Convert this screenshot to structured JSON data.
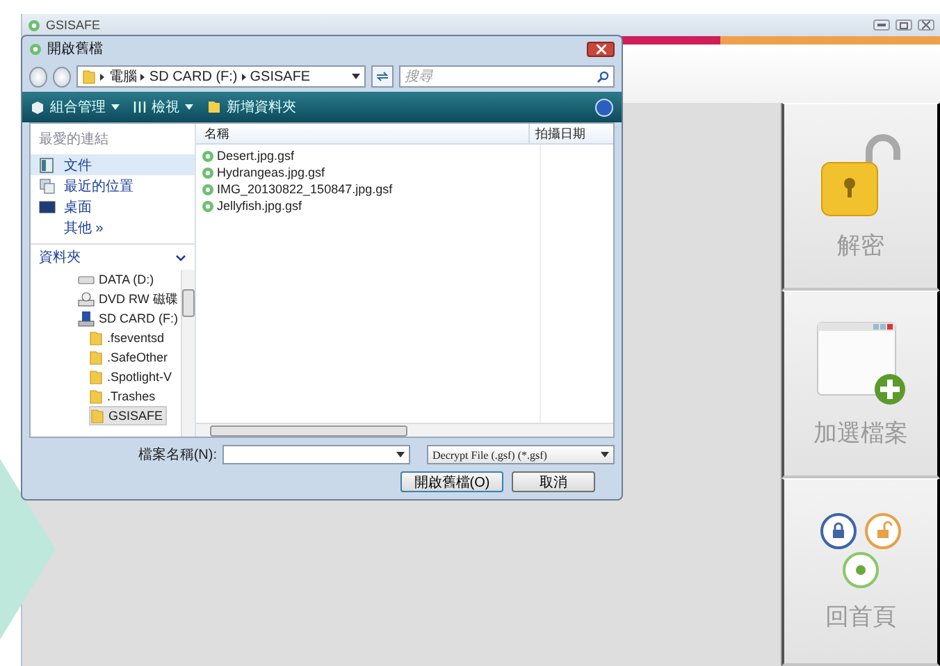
{
  "app": {
    "title": "GSISAFE"
  },
  "dialog": {
    "title": "開啟舊檔",
    "breadcrumb": [
      "電腦",
      "SD CARD (F:)",
      "GSISAFE"
    ],
    "search": {
      "placeholder": "搜尋"
    },
    "toolbar": [
      {
        "label": "組合管理",
        "kind": "organize"
      },
      {
        "label": "檢視",
        "kind": "views"
      },
      {
        "label": "新增資料夾",
        "kind": "newfolder"
      }
    ],
    "favorites_header": "最愛的連結",
    "favorites": [
      {
        "label": "文件",
        "kind": "documents",
        "selected": true
      },
      {
        "label": "最近的位置",
        "kind": "recent",
        "selected": false
      },
      {
        "label": "桌面",
        "kind": "desktop",
        "selected": false
      },
      {
        "label": "其他 »",
        "kind": "more",
        "selected": false
      }
    ],
    "folders_header": "資料夾",
    "tree": [
      {
        "label": "DATA (D:)",
        "kind": "drive",
        "selected": false
      },
      {
        "label": "DVD RW 磁碟",
        "kind": "dvd",
        "selected": false
      },
      {
        "label": "SD CARD (F:)",
        "kind": "card",
        "selected": false,
        "children": [
          {
            "label": ".fseventsd",
            "kind": "folder",
            "selected": false
          },
          {
            "label": ".SafeOther",
            "kind": "folder",
            "selected": false
          },
          {
            "label": ".Spotlight-V",
            "kind": "folder",
            "selected": false
          },
          {
            "label": ".Trashes",
            "kind": "folder",
            "selected": false
          },
          {
            "label": "GSISAFE",
            "kind": "folder",
            "selected": true
          }
        ]
      }
    ],
    "columns": [
      "名稱",
      "拍攝日期"
    ],
    "files": [
      "Desert.jpg.gsf",
      "Hydrangeas.jpg.gsf",
      "IMG_20130822_150847.jpg.gsf",
      "Jellyfish.jpg.gsf"
    ],
    "filename_label": "檔案名稱(N):",
    "filter": "Decrypt File (.gsf) (*.gsf)",
    "buttons": [
      "開啟舊檔(O)",
      "取消"
    ]
  },
  "panel": [
    {
      "label": "解密",
      "kind": "decrypt"
    },
    {
      "label": "加選檔案",
      "kind": "add"
    },
    {
      "label": "回首頁",
      "kind": "home"
    }
  ]
}
